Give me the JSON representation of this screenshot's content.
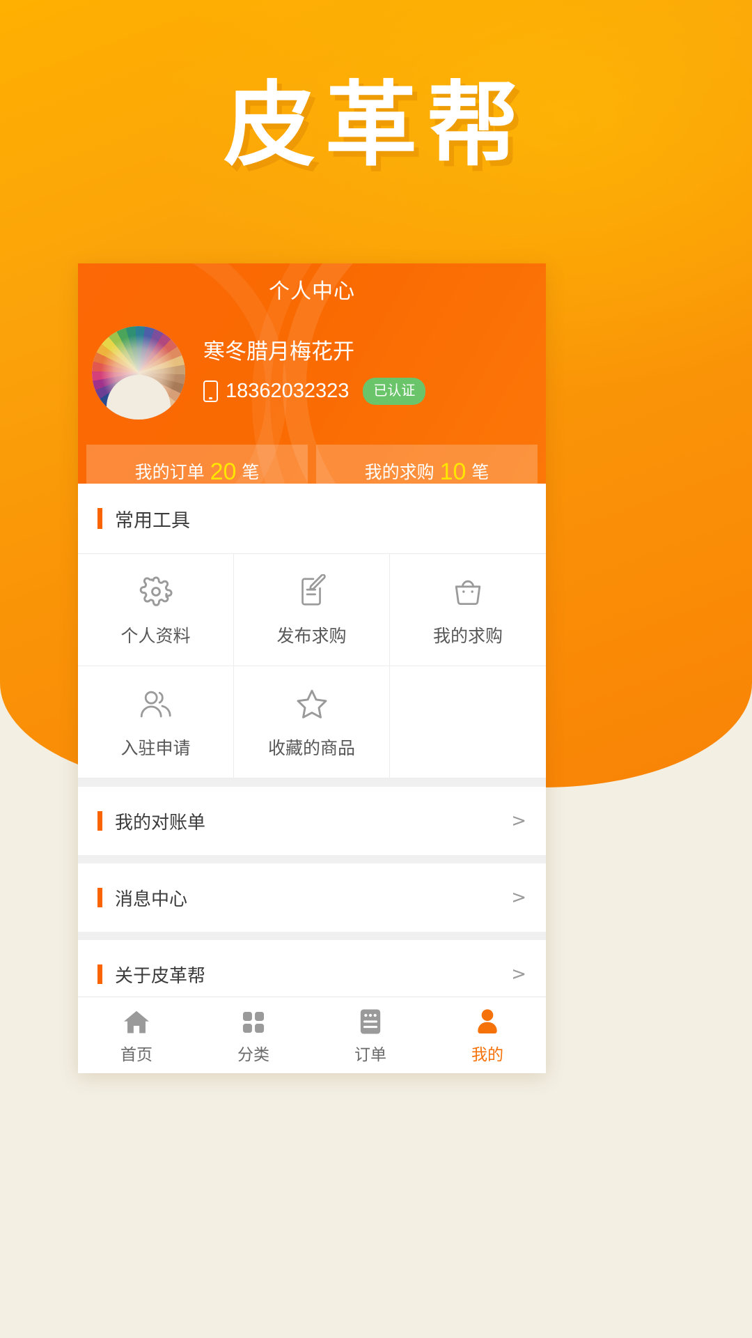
{
  "app": {
    "logo_text": "皮革帮"
  },
  "header": {
    "title": "个人中心",
    "avatar_alt": "avatar-pencils",
    "user_name": "寒冬腊月梅花开",
    "phone": "18362032323",
    "verified_badge": "已认证"
  },
  "stats": [
    {
      "label_prefix": "我的订单",
      "value": "20",
      "label_suffix": "笔"
    },
    {
      "label_prefix": "我的求购",
      "value": "10",
      "label_suffix": "笔"
    }
  ],
  "tools": {
    "section_title": "常用工具",
    "items": [
      {
        "label": "个人资料",
        "icon": "gear-icon"
      },
      {
        "label": "发布求购",
        "icon": "document-edit-icon"
      },
      {
        "label": "我的求购",
        "icon": "shopping-bag-icon"
      },
      {
        "label": "入驻申请",
        "icon": "users-icon"
      },
      {
        "label": "收藏的商品",
        "icon": "star-icon"
      }
    ]
  },
  "list": [
    {
      "label": "我的对账单",
      "chevron": ">"
    },
    {
      "label": "消息中心",
      "chevron": ">"
    },
    {
      "label": "关于皮革帮",
      "chevron": ">"
    }
  ],
  "tabbar": [
    {
      "label": "首页",
      "icon": "home-icon",
      "active": false
    },
    {
      "label": "分类",
      "icon": "grid-icon",
      "active": false
    },
    {
      "label": "订单",
      "icon": "order-list-icon",
      "active": false
    },
    {
      "label": "我的",
      "icon": "person-icon",
      "active": true
    }
  ],
  "colors": {
    "brand_orange": "#fa6400",
    "gradient_top": "#ffb000",
    "gradient_bottom": "#f98306",
    "accent_yellow": "#ffe600",
    "verified_green": "#69c46a",
    "active_tab": "#f5720b",
    "icon_gray": "#9a9a9a"
  }
}
